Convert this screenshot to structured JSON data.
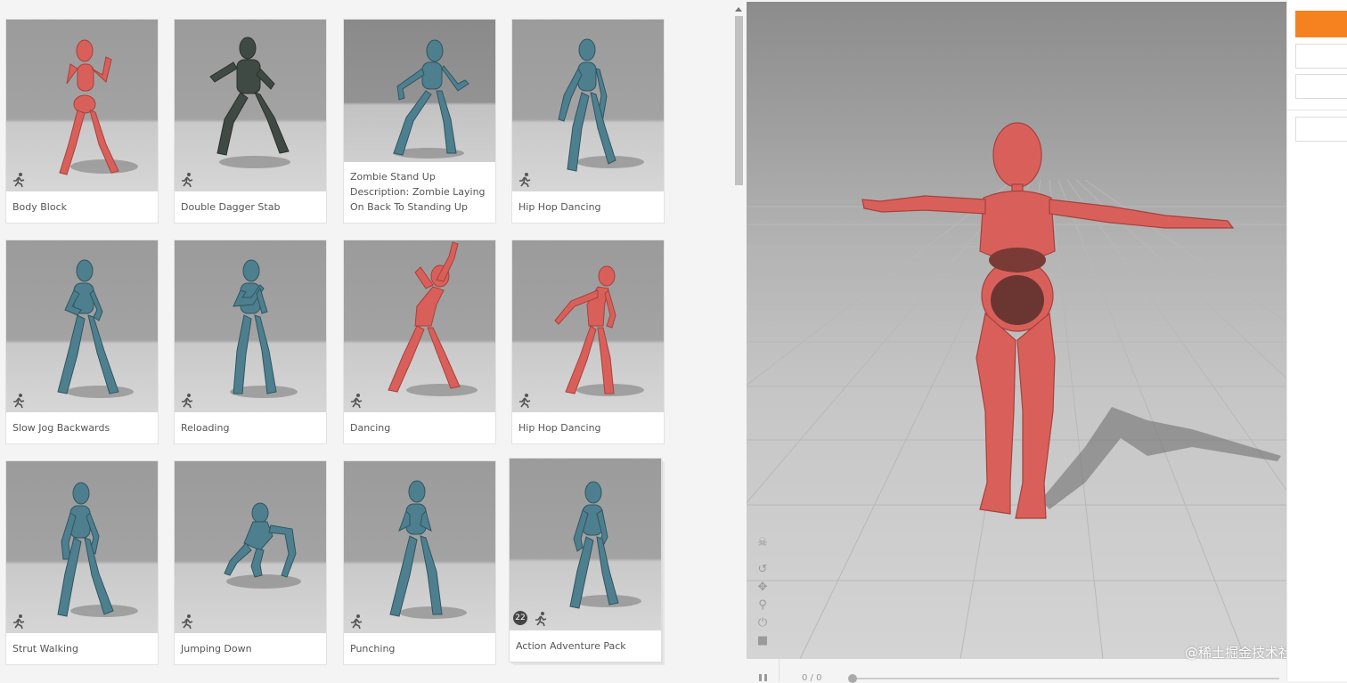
{
  "library": {
    "cards": [
      {
        "label": "Body Block",
        "color": "red"
      },
      {
        "label": "Double Dagger Stab",
        "color": "soldier"
      },
      {
        "label": "Zombie Stand Up Description: Zombie Laying On Back To Standing Up",
        "color": "blue"
      },
      {
        "label": "Hip Hop Dancing",
        "color": "blue"
      },
      {
        "label": "Slow Jog Backwards",
        "color": "blue"
      },
      {
        "label": "Reloading",
        "color": "blue"
      },
      {
        "label": "Dancing",
        "color": "red"
      },
      {
        "label": "Hip Hop Dancing",
        "color": "red"
      },
      {
        "label": "Strut Walking",
        "color": "blue"
      },
      {
        "label": "Jumping Down",
        "color": "blue"
      },
      {
        "label": "Punching",
        "color": "blue"
      },
      {
        "label": "Action Adventure Pack",
        "color": "blue",
        "pack_count": "22"
      }
    ],
    "icon": "running-figure-icon"
  },
  "viewport": {
    "tools": [
      "skull-icon",
      "undo-icon",
      "move-icon",
      "zoom-icon",
      "power-icon",
      "camera-icon"
    ]
  },
  "timeline": {
    "frame_text": "0 / 0",
    "progress": 0
  },
  "watermark": "@稀土掘金技术社区",
  "colors": {
    "accent": "#f5821f",
    "red_figure": "#d9605a",
    "blue_figure": "#4e7f8e"
  }
}
